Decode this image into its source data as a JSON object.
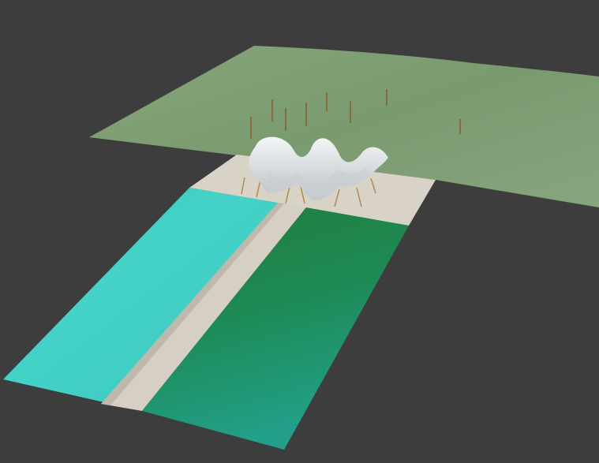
{
  "scene": {
    "background_color": "#3d3d3d",
    "terrain_color": "#7f9e74",
    "plaza_color": "#d9d3c7",
    "walkway_color": "#d6cfc3",
    "left_pool_color": "#3fcfc6",
    "right_pool_color": "#1f8a5e",
    "canopy_color": "#e9ecee",
    "pole_color": "#8a6a3a"
  }
}
